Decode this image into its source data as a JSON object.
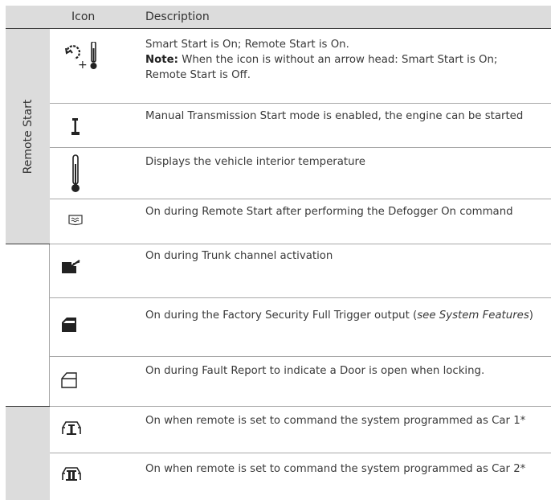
{
  "header": {
    "icon": "Icon",
    "description": "Description"
  },
  "groups": [
    {
      "label": "Remote Start"
    },
    {
      "label": ""
    },
    {
      "label": ""
    }
  ],
  "rows": [
    {
      "icon": "smart-start-remote-start-icon",
      "plus": "+",
      "line1": "Smart Start is On; Remote Start is On.",
      "note_label": "Note:",
      "note_text": " When the icon is without an arrow head: Smart Start is On; Remote Start is Off."
    },
    {
      "icon": "manual-transmission-icon",
      "text": "Manual Transmission Start mode is enabled, the engine can be started"
    },
    {
      "icon": "thermometer-icon",
      "text": "Displays the vehicle interior temperature"
    },
    {
      "icon": "defogger-icon",
      "text": "On during Remote Start after performing the  Defogger On command"
    },
    {
      "icon": "trunk-icon",
      "text": "On during Trunk channel activation"
    },
    {
      "icon": "door-filled-icon",
      "text_pre": "On during the Factory Security Full Trigger output (",
      "text_italic": "see System Features",
      "text_post": ")"
    },
    {
      "icon": "door-open-icon",
      "text": "On during Fault Report to indicate a Door is open when locking."
    },
    {
      "icon": "car-1-icon",
      "text": "On when remote is set to command the system programmed as Car 1*"
    },
    {
      "icon": "car-2-icon",
      "text": "On when remote is set to command the system programmed as Car 2*"
    }
  ]
}
